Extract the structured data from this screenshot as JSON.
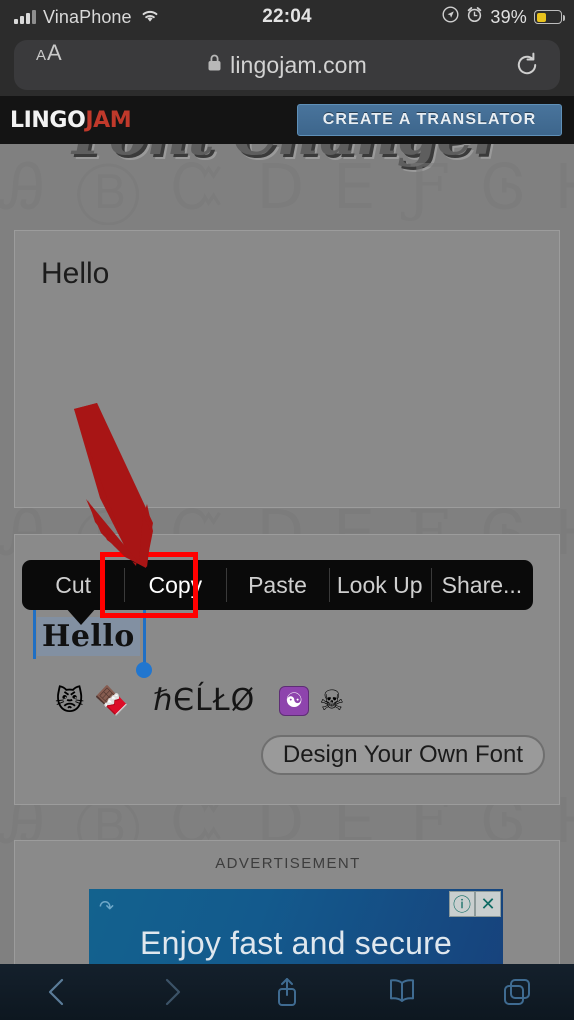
{
  "status_bar": {
    "carrier": "VinaPhone",
    "time": "22:04",
    "battery_percent": "39%",
    "icons": [
      "signal-bars-icon",
      "wifi-icon",
      "location-arrow-icon",
      "alarm-clock-icon",
      "battery-icon"
    ],
    "battery_color": "#e8c21d"
  },
  "browser": {
    "text_size_small": "A",
    "text_size_large": "A",
    "url": "lingojam.com",
    "lock_icon": "lock-icon",
    "reload_icon": "reload-icon",
    "toolbar": {
      "back": "back-chevron-icon",
      "forward": "forward-chevron-icon",
      "share": "share-icon",
      "bookmarks": "book-icon",
      "tabs": "tabs-icon"
    }
  },
  "site": {
    "logo_part1": "LINGO",
    "logo_part2": "JAM",
    "create_button": "CREATE A TRANSLATOR",
    "hero_title": "Font Changer",
    "watermark": "Ꭿ Ⓑ Ꮸ ᗞ Ꭼ Ƒ Ꮆ Ꮋ",
    "accent_red": "#c0392b",
    "accent_blue": "#49749c"
  },
  "translator": {
    "input_value": "Hello",
    "selected_output": "Hello",
    "styled_row": {
      "emoji_left": [
        "😾",
        "🍫"
      ],
      "styled_text": "ℏЄĹŁØ",
      "yin_yang": "☯",
      "skull": "☠"
    },
    "design_button": "Design Your Own Font"
  },
  "edit_menu": {
    "items": [
      {
        "label": "Cut",
        "selected": false
      },
      {
        "label": "Copy",
        "selected": true
      },
      {
        "label": "Paste",
        "selected": false
      },
      {
        "label": "Look Up",
        "selected": false
      },
      {
        "label": "Share...",
        "selected": false
      }
    ],
    "highlight_color": "#ff0000"
  },
  "annotation": {
    "arrow_color": "#a81515",
    "arrow_target": "Copy"
  },
  "ad": {
    "label": "ADVERTISEMENT",
    "headline": "Enjoy fast and secure",
    "info_icon": "info-icon",
    "close_icon": "close-icon",
    "loop_icon": "loop-icon"
  }
}
